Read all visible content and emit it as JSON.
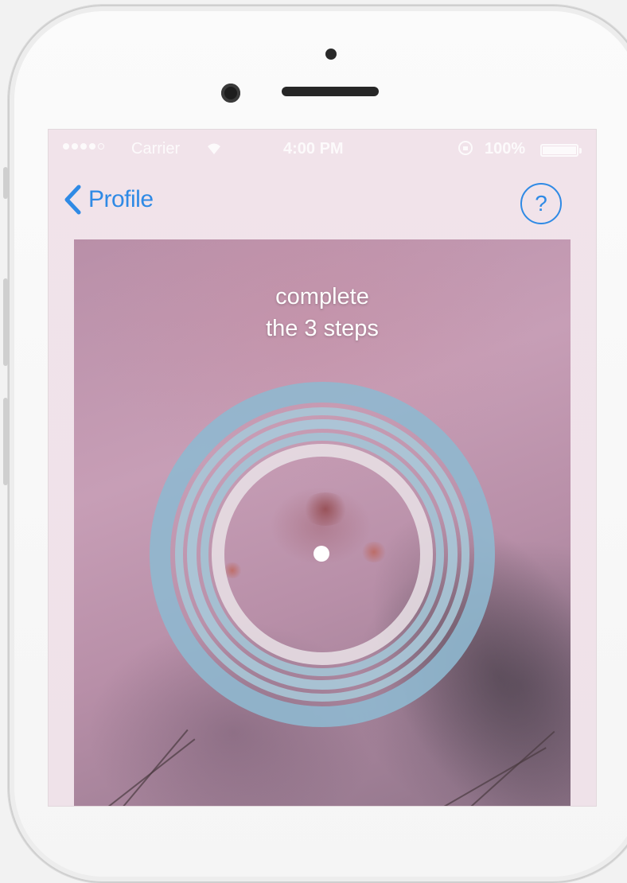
{
  "status_bar": {
    "carrier": "Carrier",
    "time": "4:00 PM",
    "battery": "100%",
    "icons": [
      "signal-dots-icon",
      "wifi-icon",
      "rotation-lock-icon",
      "battery-icon"
    ]
  },
  "nav": {
    "back_label": "Profile",
    "help_label": "?"
  },
  "camera": {
    "instruction_line1": "complete",
    "instruction_line2": "the 3 steps",
    "target_icon": "concentric-rings-target"
  },
  "colors": {
    "accent": "#2f8ae5",
    "ring": "#8fb8cf",
    "ring_light": "#a9c9d9"
  }
}
